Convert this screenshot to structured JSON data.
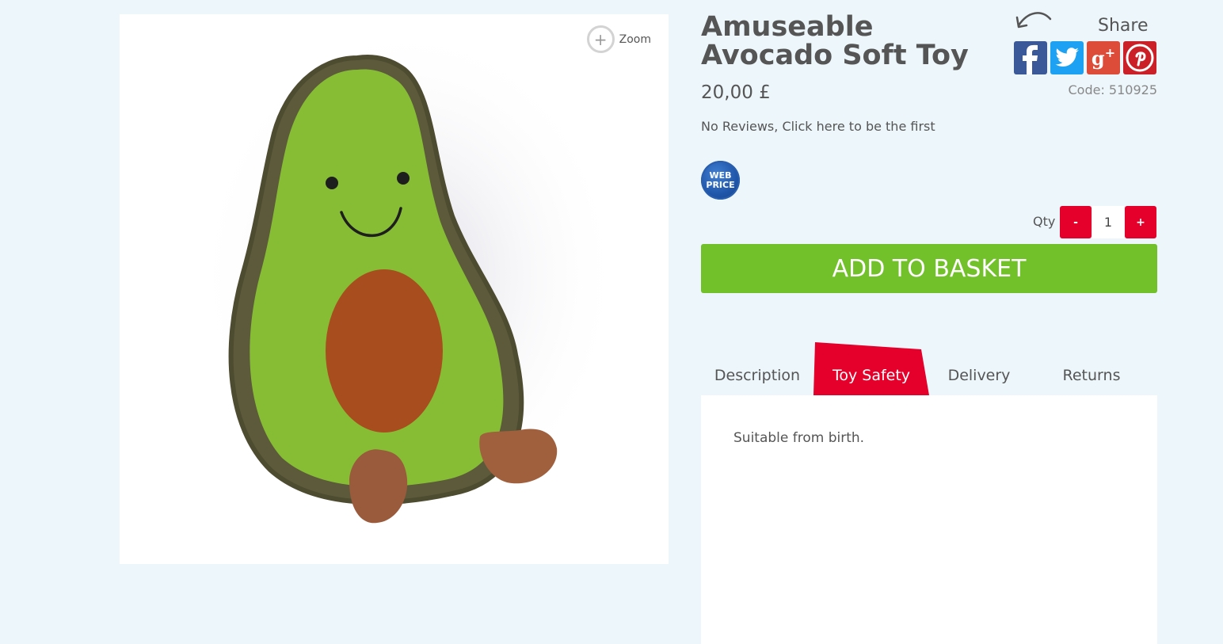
{
  "product": {
    "title": "Amuseable Avocado Soft Toy",
    "price": "20,00 £",
    "reviews_text": "No Reviews, Click here to be the first",
    "badge_text": "WEB PRICE",
    "code": "Code: 510925"
  },
  "gallery": {
    "zoom_label": "Zoom",
    "zoom_icon": "plus-circle-icon"
  },
  "share": {
    "label": "Share",
    "arrow_icon": "curved-arrow-icon",
    "networks": [
      {
        "name": "facebook",
        "glyph": "f",
        "color": "#3b5998"
      },
      {
        "name": "twitter",
        "glyph": "bird",
        "color": "#1da1f2"
      },
      {
        "name": "google-plus",
        "glyph": "g+",
        "color": "#dd4b39"
      },
      {
        "name": "pinterest",
        "glyph": "P",
        "color": "#cb2027"
      }
    ]
  },
  "purchase": {
    "qty_label": "Qty",
    "minus_label": "-",
    "plus_label": "+",
    "qty_value": "1",
    "add_label": "ADD TO BASKET"
  },
  "tabs": {
    "items": [
      "Description",
      "Toy Safety",
      "Delivery",
      "Returns"
    ],
    "active": "Toy Safety",
    "content": "Suitable from birth."
  },
  "colors": {
    "background": "#edf6fa",
    "accent_red": "#e4002b",
    "basket_green": "#73c12a"
  }
}
